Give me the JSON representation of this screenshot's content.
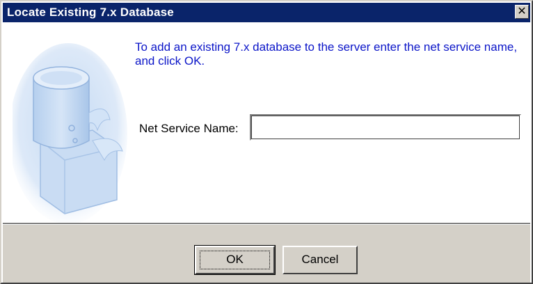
{
  "window": {
    "title": "Locate Existing 7.x Database",
    "close_symbol": "✕"
  },
  "dialog": {
    "instruction": "To add an existing 7.x database to the server enter the net service name, and click OK.",
    "net_service_name_label": "Net Service Name:",
    "net_service_name_value": ""
  },
  "buttons": {
    "ok_label": "OK",
    "cancel_label": "Cancel"
  },
  "icons": {
    "illustration": "database-cylinder-illustration",
    "close": "close-icon"
  },
  "colors": {
    "titlebar": "#0a246a",
    "instruction_text": "#0a14c8",
    "dialog_face": "#d4d0c8"
  }
}
